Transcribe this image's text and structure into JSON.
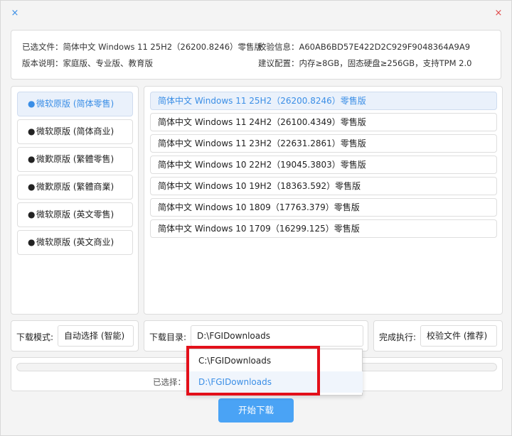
{
  "window": {
    "close_left_glyph": "×",
    "close_right_glyph": "×",
    "accent_color": "#3a8ee6",
    "close_color": "#e04848"
  },
  "info": {
    "selected_file_label": "已选文件：",
    "selected_file_value": "简体中文 Windows 11 25H2（26200.8246）零售版",
    "checksum_label": "校验信息：",
    "checksum_value": "A60AB6BD57E422D2C929F9048364A9A9",
    "edition_label": "版本说明：",
    "edition_value": "家庭版、专业版、教育版",
    "config_label": "建议配置：",
    "config_value": "内存≥8GB，固态硬盘≥256GB，支持TPM 2.0"
  },
  "sidebar": {
    "bullet": "●",
    "items": [
      {
        "label": "微软原版 (简体零售)"
      },
      {
        "label": "微软原版 (简体商业)"
      },
      {
        "label": "微歎原版 (繁體零售)"
      },
      {
        "label": "微歎原版 (繁體商業)"
      },
      {
        "label": "微软原版 (英文零售)"
      },
      {
        "label": "微软原版 (英文商业)"
      }
    ],
    "active_index": 0
  },
  "versions": {
    "items": [
      {
        "label": "简体中文 Windows 11 25H2（26200.8246）零售版"
      },
      {
        "label": "简体中文 Windows 11 24H2（26100.4349）零售版"
      },
      {
        "label": "简体中文 Windows 11 23H2（22631.2861）零售版"
      },
      {
        "label": "简体中文 Windows 10 22H2（19045.3803）零售版"
      },
      {
        "label": "简体中文 Windows 10 19H2（18363.592）零售版"
      },
      {
        "label": "简体中文 Windows 10 1809（17763.379）零售版"
      },
      {
        "label": "简体中文 Windows 10 1709（16299.125）零售版"
      }
    ],
    "active_index": 0
  },
  "options": {
    "mode_label": "下载模式:",
    "mode_value": "自动选择 (智能)",
    "dir_label": "下载目录:",
    "dir_value": "D:\\FGIDownloads",
    "finish_label": "完成执行:",
    "finish_value": "校验文件 (推荐)"
  },
  "dropdown": {
    "options": [
      {
        "label": "C:\\FGIDownloads"
      },
      {
        "label": "D:\\FGIDownloads"
      }
    ],
    "selected_index": 1,
    "highlight_color": "#e3101a"
  },
  "progress": {
    "selected_text": "已选择：简",
    "value": 0
  },
  "start_button": {
    "label": "开始下载",
    "color": "#4aa3f5"
  }
}
